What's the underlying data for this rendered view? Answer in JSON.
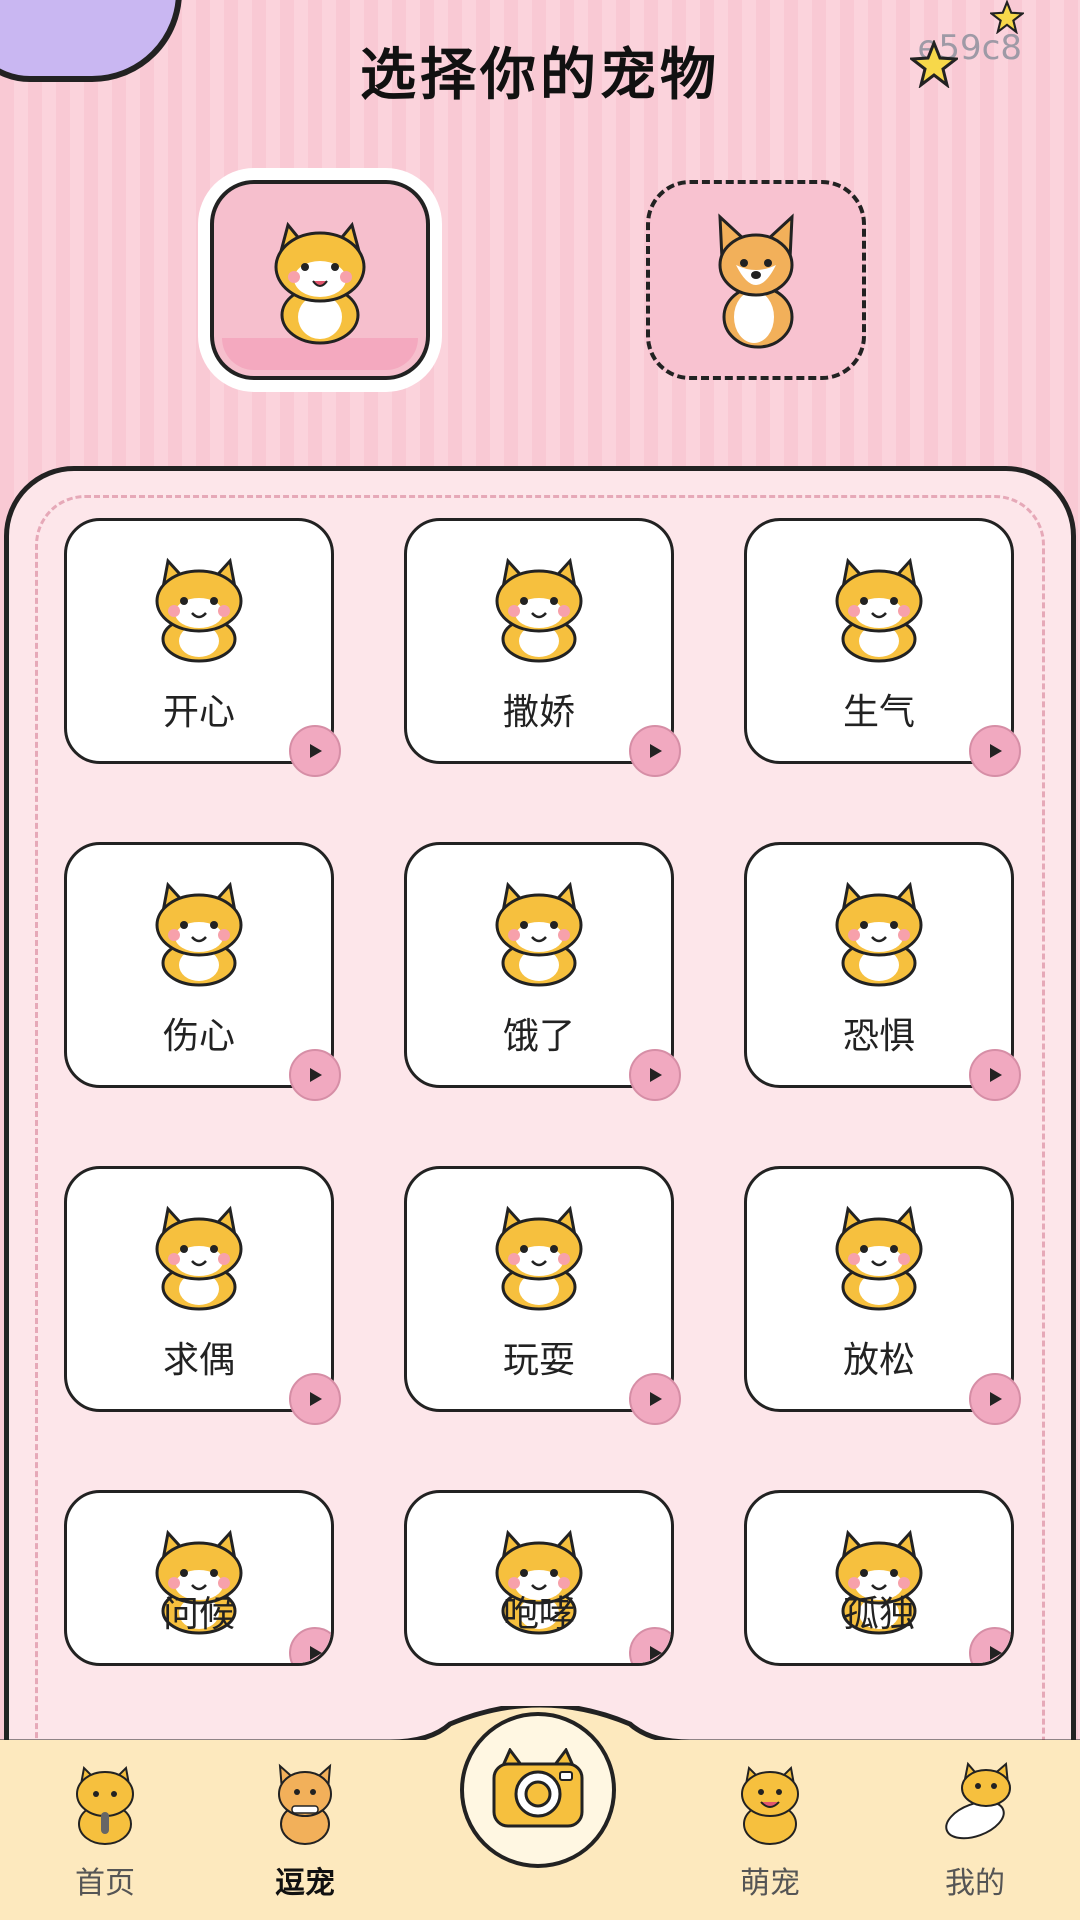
{
  "header": {
    "title": "选择你的宠物",
    "code": "e59c8"
  },
  "pets": [
    {
      "name": "cat",
      "selected": true
    },
    {
      "name": "dog",
      "selected": false
    }
  ],
  "emotions": [
    {
      "label": "开心"
    },
    {
      "label": "撒娇"
    },
    {
      "label": "生气"
    },
    {
      "label": "伤心"
    },
    {
      "label": "饿了"
    },
    {
      "label": "恐惧"
    },
    {
      "label": "求偶"
    },
    {
      "label": "玩耍"
    },
    {
      "label": "放松"
    },
    {
      "label": "问候"
    },
    {
      "label": "咆哮"
    },
    {
      "label": "孤独"
    }
  ],
  "nav": [
    {
      "label": "首页",
      "active": false
    },
    {
      "label": "逗宠",
      "active": true
    },
    {
      "label": "萌宠",
      "active": false
    },
    {
      "label": "我的",
      "active": false
    }
  ],
  "colors": {
    "accent": "#f1a9c0",
    "cat": "#f6c03e",
    "bar": "#fde9be"
  }
}
